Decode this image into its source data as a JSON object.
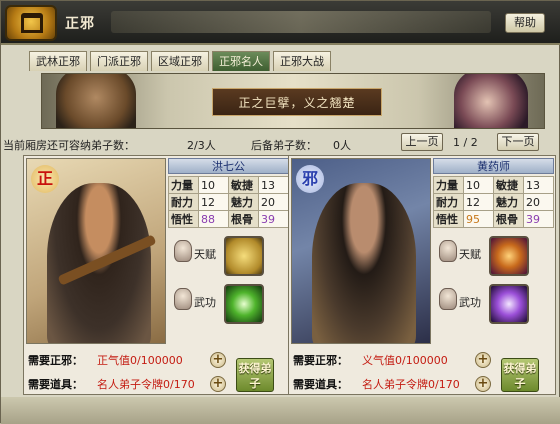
{
  "window": {
    "title": "正邪",
    "help_label": "帮助"
  },
  "tabs": [
    {
      "label": "武林正邪",
      "active": false
    },
    {
      "label": "门派正邪",
      "active": false
    },
    {
      "label": "区域正邪",
      "active": false
    },
    {
      "label": "正邪名人",
      "active": true
    },
    {
      "label": "正邪大战",
      "active": false
    }
  ],
  "banner": {
    "slogan": "正之巨擘，义之翘楚"
  },
  "info": {
    "capacity_label": "当前厢房还可容纳弟子数：",
    "capacity_value": "2/3人",
    "reserve_label": "后备弟子数：",
    "reserve_value": "0人",
    "prev_label": "上一页",
    "page_indicator": "1 / 2",
    "next_label": "下一页"
  },
  "heroes": [
    {
      "side_mark": "正",
      "name": "洪七公",
      "stats": {
        "liliang_label": "力量",
        "liliang": "10",
        "minjie_label": "敏捷",
        "minjie": "13",
        "naili_label": "耐力",
        "naili": "12",
        "meili_label": "魅力",
        "meili": "20",
        "wuxing_label": "悟性",
        "wuxing": "88",
        "gengu_label": "根骨",
        "gengu": "39"
      },
      "talent_label": "天赋",
      "skill_label": "武功",
      "req_alignment_label": "需要正邪：",
      "req_alignment_value": "正气值0/100000",
      "req_item_label": "需要道具：",
      "req_item_value": "名人弟子令牌0/170",
      "get_button": "获得弟子"
    },
    {
      "side_mark": "邪",
      "name": "黄药师",
      "stats": {
        "liliang_label": "力量",
        "liliang": "10",
        "minjie_label": "敏捷",
        "minjie": "13",
        "naili_label": "耐力",
        "naili": "12",
        "meili_label": "魅力",
        "meili": "20",
        "wuxing_label": "悟性",
        "wuxing": "95",
        "gengu_label": "根骨",
        "gengu": "39"
      },
      "talent_label": "天赋",
      "skill_label": "武功",
      "req_alignment_label": "需要正邪：",
      "req_alignment_value": "义气值0/100000",
      "req_item_label": "需要道具：",
      "req_item_value": "名人弟子令牌0/170",
      "get_button": "获得弟子"
    }
  ],
  "colors": {
    "accent_green": "#6d8a2c",
    "requirement_red": "#c41c12",
    "name_blue": "#1a2e6e"
  }
}
